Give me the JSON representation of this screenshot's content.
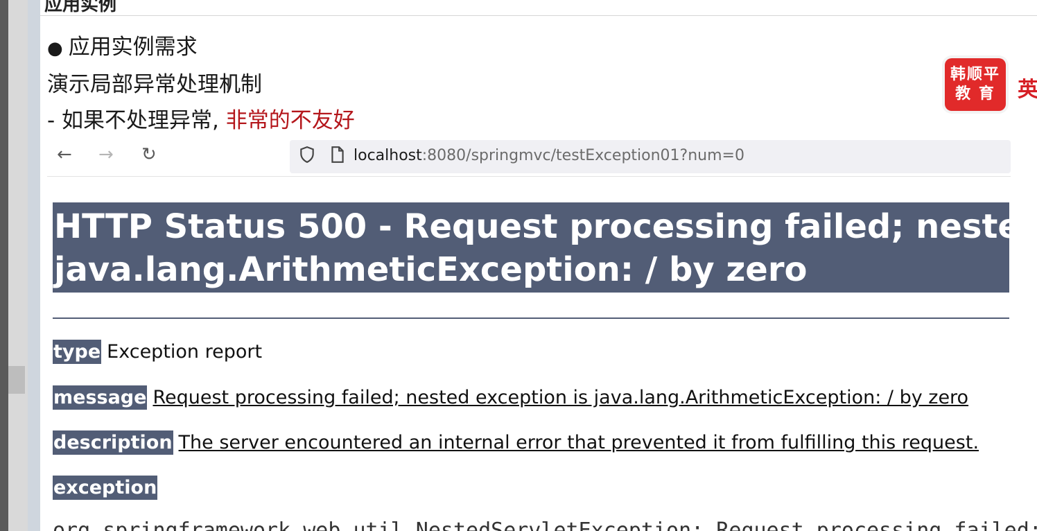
{
  "slide": {
    "title": "应用实例",
    "bullet_glyph": "●",
    "bullet_text": "应用实例需求",
    "line2": "演示局部异常处理机制",
    "line3_prefix": "- 如果不处理异常,",
    "line3_red": "非常的不友好",
    "logo_top": "韩顺平",
    "logo_bottom": "教 育",
    "logo_side": "英"
  },
  "browser": {
    "back_icon": "←",
    "forward_icon": "→",
    "reload_icon": "↻",
    "url_host": "localhost",
    "url_rest": ":8080/springmvc/testException01?num=0"
  },
  "error": {
    "heading_line1": "HTTP Status 500 - Request processing failed; neste",
    "heading_line2": "java.lang.ArithmeticException: / by zero",
    "type_label": "type",
    "type_value": "Exception report",
    "message_label": "message",
    "message_value": "Request processing failed; nested exception is java.lang.ArithmeticException: / by zero",
    "description_label": "description",
    "description_value": "The server encountered an internal error that prevented it from fulfilling this request.",
    "exception_label": "exception",
    "trace_partial": "org.springframework.web.util.NestedServletException: Request processing failed;"
  }
}
